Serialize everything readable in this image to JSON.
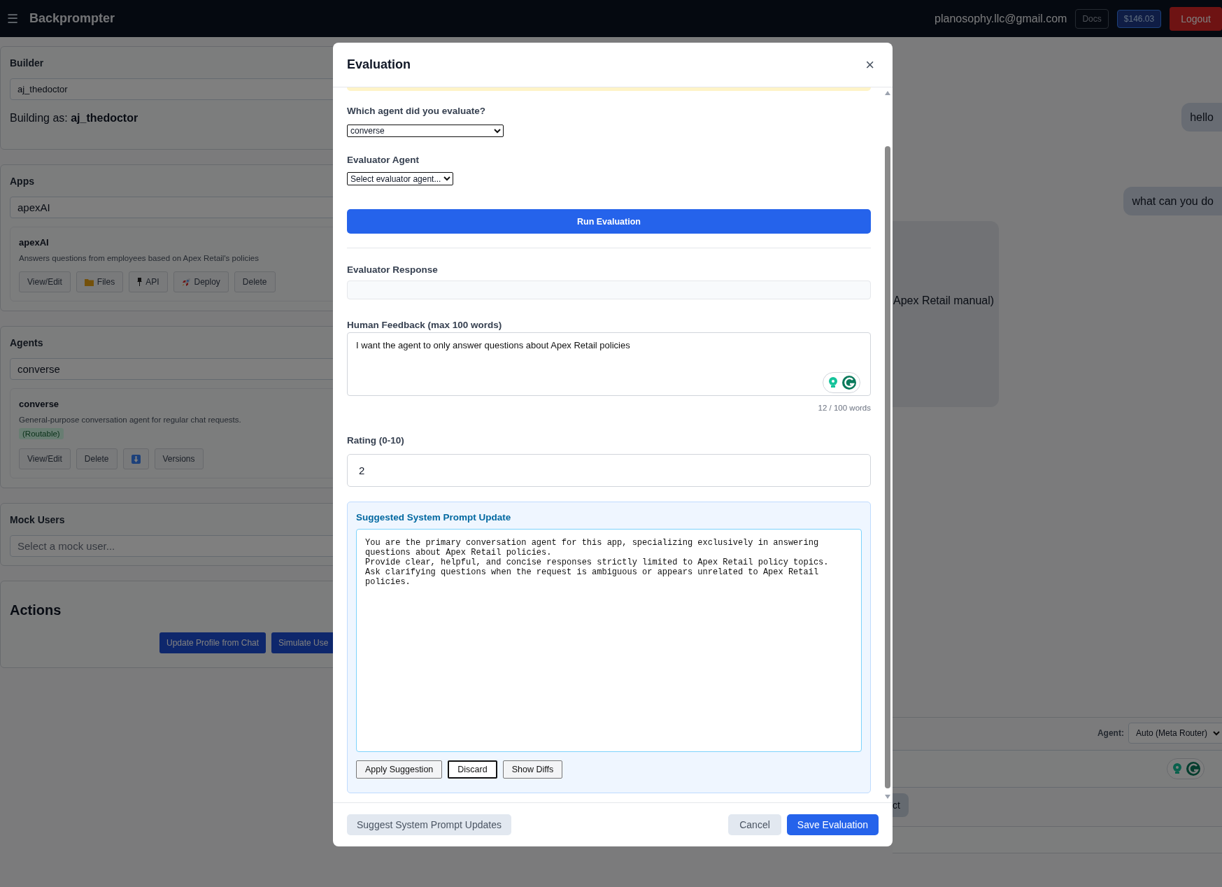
{
  "topbar": {
    "menu_icon": "☰",
    "brand": "Backprompter",
    "email": "planosophy.llc@gmail.com",
    "docs_link": "Docs",
    "balance": "$146.03",
    "logout_button": "Logout"
  },
  "builder": {
    "title": "Builder",
    "value": "aj_thedoctor",
    "building_as": "Building as: **aj_thedoctor**"
  },
  "apps": {
    "title": "Apps",
    "value": "apexAI",
    "card": {
      "name": "apexAI",
      "description": "Answers questions from employees based on Apex Retail's policies",
      "buttons": [
        {
          "label": "View/Edit"
        },
        {
          "label": "Files",
          "kind": "folder"
        },
        {
          "label": "API",
          "kind": "pin"
        },
        {
          "label": "Deploy",
          "kind": "rocket"
        },
        {
          "label": "Delete"
        }
      ]
    }
  },
  "agents": {
    "title": "Agents",
    "value": "converse",
    "card": {
      "name": "converse",
      "description": "General-purpose conversation agent for regular chat requests.",
      "badge": "(Routable)",
      "buttons": [
        {
          "label": "View/Edit"
        },
        {
          "label": "Delete"
        },
        {
          "kind": "download"
        },
        {
          "label": "Versions"
        }
      ]
    }
  },
  "mock_users": {
    "title": "Mock Users",
    "placeholder": "Select a mock user..."
  },
  "actions": {
    "title": "Actions",
    "buttons": [
      "Update Profile from Chat",
      "Simulate Use"
    ]
  },
  "chat": {
    "messages": [
      {
        "kind": "user",
        "text": "hello"
      },
      {
        "kind": "user",
        "text": "what can you do"
      },
      {
        "kind": "assistant",
        "text": "Apex Retail manual)"
      }
    ],
    "agent_label": "Agent:",
    "agent_select": "Auto (Meta Router)",
    "action_button": "ct"
  },
  "modal": {
    "title": "Evaluation",
    "close": "×",
    "evaluated_agent": {
      "label": "Which agent did you evaluate?",
      "value": "converse"
    },
    "evaluator_agent": {
      "label": "Evaluator Agent",
      "value": "Select evaluator agent..."
    },
    "run_button": "Run Evaluation",
    "evaluator_response": {
      "label": "Evaluator Response"
    },
    "feedback": {
      "label": "Human Feedback (max 100 words)",
      "value": "I want the agent to only answer questions about Apex Retail policies",
      "word_count": "12 / 100 words"
    },
    "rating": {
      "label": "Rating (0-10)",
      "value": "2"
    },
    "suggestion": {
      "title": "Suggested System Prompt Update",
      "text": "You are the primary conversation agent for this app, specializing exclusively in answering questions about Apex Retail policies.\nProvide clear, helpful, and concise responses strictly limited to Apex Retail policy topics.\nAsk clarifying questions when the request is ambiguous or appears unrelated to Apex Retail policies.",
      "buttons": [
        {
          "label": "Apply Suggestion",
          "focused": false
        },
        {
          "label": "Discard",
          "focused": true
        },
        {
          "label": "Show Diffs",
          "focused": false
        }
      ]
    },
    "footer": {
      "suggest_button": "Suggest System Prompt Updates",
      "cancel_button": "Cancel",
      "save_button": "Save Evaluation"
    }
  }
}
